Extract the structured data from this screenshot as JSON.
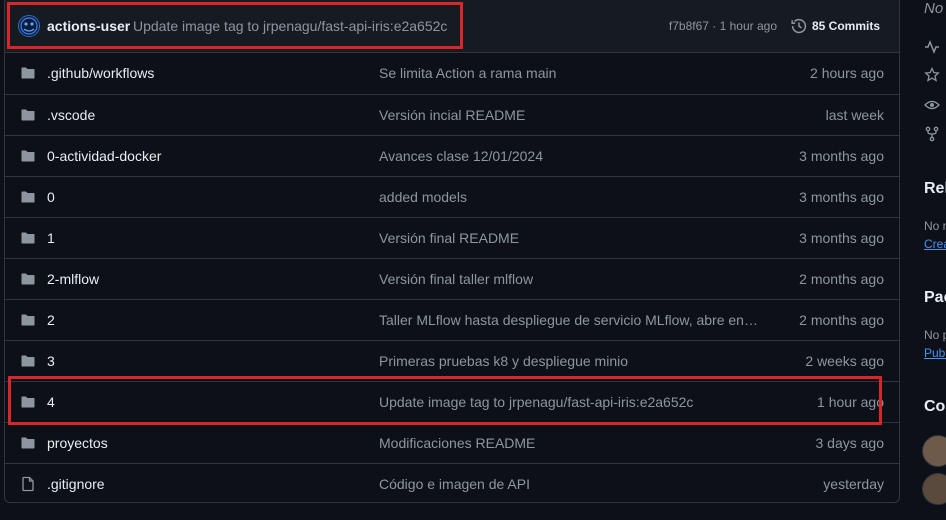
{
  "latest_commit": {
    "author": "actions-user",
    "message": "Update image tag to jrpenagu/fast-api-iris:e2a652c",
    "meta": "f7b8f67 · 1 hour ago",
    "commits_label": "85 Commits",
    "history_icon": "history-icon",
    "avatar_icon": "avatar-icon"
  },
  "files": [
    {
      "name": ".github/workflows",
      "type": "folder",
      "message": "Se limita Action a rama main",
      "time": "2 hours ago"
    },
    {
      "name": ".vscode",
      "type": "folder",
      "message": "Versión incial README",
      "time": "last week"
    },
    {
      "name": "0-actividad-docker",
      "type": "folder",
      "message": "Avances clase 12/01/2024",
      "time": "3 months ago"
    },
    {
      "name": "0",
      "type": "folder",
      "message": "added models",
      "time": "3 months ago"
    },
    {
      "name": "1",
      "type": "folder",
      "message": "Versión final README",
      "time": "3 months ago"
    },
    {
      "name": "2-mlflow",
      "type": "folder",
      "message": "Versión final taller mlflow",
      "time": "2 months ago"
    },
    {
      "name": "2",
      "type": "folder",
      "message": "Taller MLflow hasta despliegue de servicio MLflow, abre en i...",
      "time": "2 months ago"
    },
    {
      "name": "3",
      "type": "folder",
      "message": "Primeras pruebas k8 y despliegue minio",
      "time": "2 weeks ago"
    },
    {
      "name": "4",
      "type": "folder",
      "message": "Update image tag to jrpenagu/fast-api-iris:e2a652c",
      "time": "1 hour ago"
    },
    {
      "name": "proyectos",
      "type": "folder",
      "message": "Modificaciones README",
      "time": "3 days ago"
    },
    {
      "name": ".gitignore",
      "type": "file",
      "message": "Código e imagen de API",
      "time": "yesterday"
    }
  ],
  "sidebar": {
    "no_description": "No",
    "releases_heading": "Rel",
    "releases_empty": "No r",
    "releases_link": "Crea",
    "packages_heading": "Pac",
    "packages_empty": "No p",
    "packages_link": "Publ",
    "contributors_heading": "Co",
    "icons": [
      "activity-icon",
      "star-icon",
      "eye-icon",
      "fork-icon"
    ]
  },
  "colors": {
    "background": "#0d1117",
    "header_bg": "#161b22",
    "border": "#30363d",
    "muted_text": "#8d96a0",
    "link": "#4493f8",
    "highlight": "#d8262c"
  }
}
